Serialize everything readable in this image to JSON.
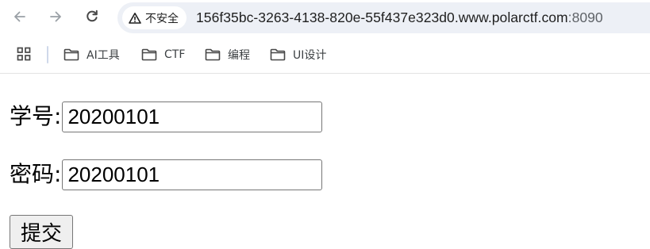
{
  "browser": {
    "security_label": "不安全",
    "url_host": "156f35bc-3263-4138-820e-55f437e323d0.www.polarctf.com",
    "url_rest": ":8090"
  },
  "bookmarks": [
    {
      "label": "AI工具"
    },
    {
      "label": "CTF"
    },
    {
      "label": "编程"
    },
    {
      "label": "UI设计"
    }
  ],
  "form": {
    "student_id_label": "学号:",
    "student_id_value": "20200101",
    "password_label": "密码:",
    "password_value": "20200101",
    "submit_label": "提交"
  },
  "icons": {
    "back": "arrow-left-icon",
    "forward": "arrow-right-icon",
    "reload": "reload-icon",
    "warning": "warning-triangle-icon",
    "apps": "apps-grid-icon",
    "folder": "folder-icon"
  }
}
